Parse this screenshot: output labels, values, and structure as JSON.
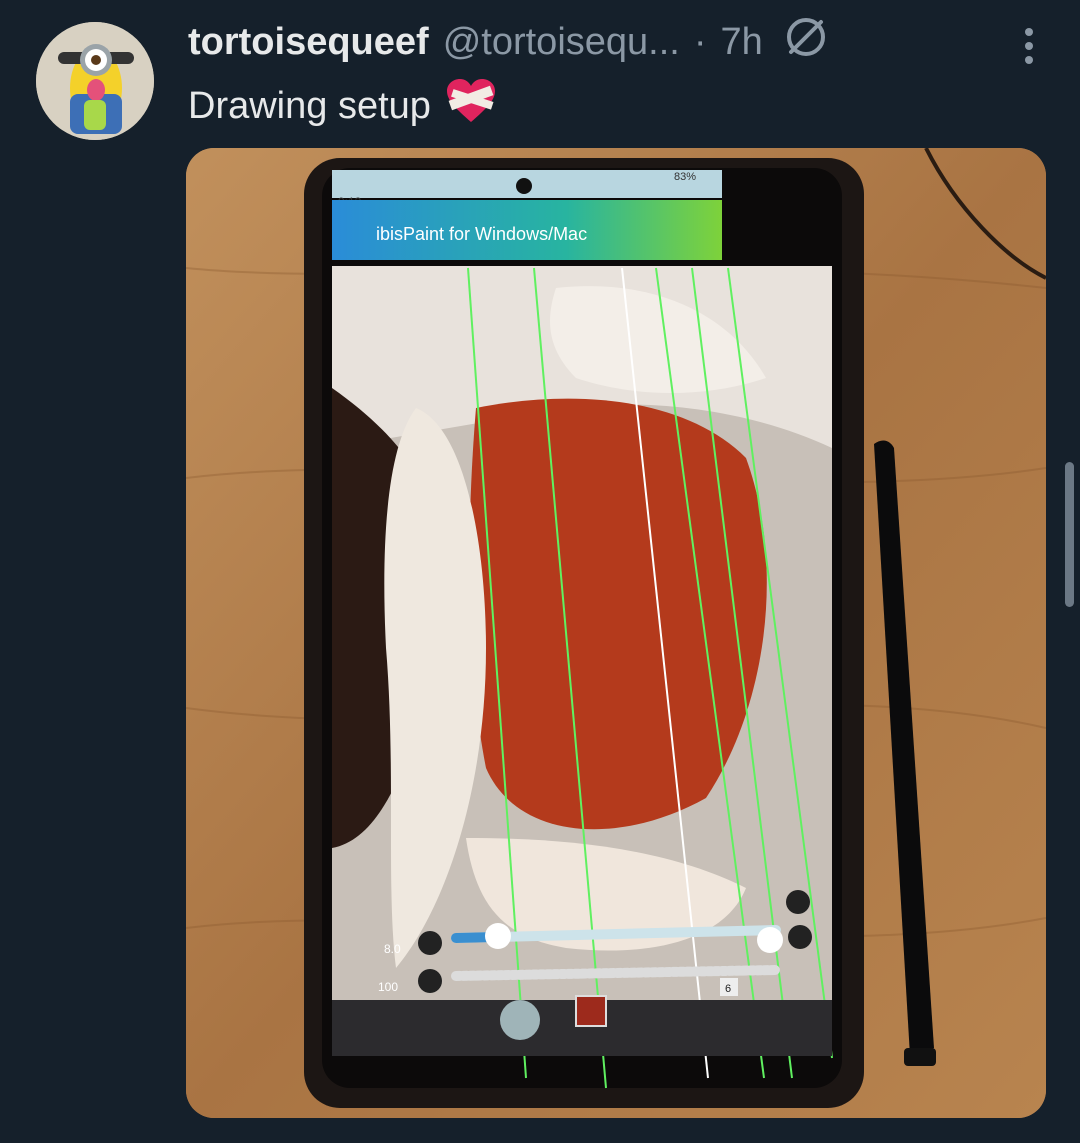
{
  "tweet": {
    "display_name": "tortoisequeef",
    "handle": "@tortoisequ...",
    "separator": "·",
    "time": "7h",
    "text": "Drawing setup",
    "emoji_icon": "mending-heart-icon",
    "status_icon": "no-entry-icon",
    "more_icon": "more-vertical-icon"
  },
  "phone_screen": {
    "clock": "9:13",
    "battery": "83%",
    "app_banner": "ibisPaint  for Windows/Mac",
    "slider_size_value": "8.0",
    "slider_opacity_value": "100",
    "layer_count": "6"
  },
  "colors": {
    "background": "#15202b",
    "primary_text": "#e7e9ea",
    "secondary_text": "#8b98a5",
    "heart": "#e0245e"
  }
}
